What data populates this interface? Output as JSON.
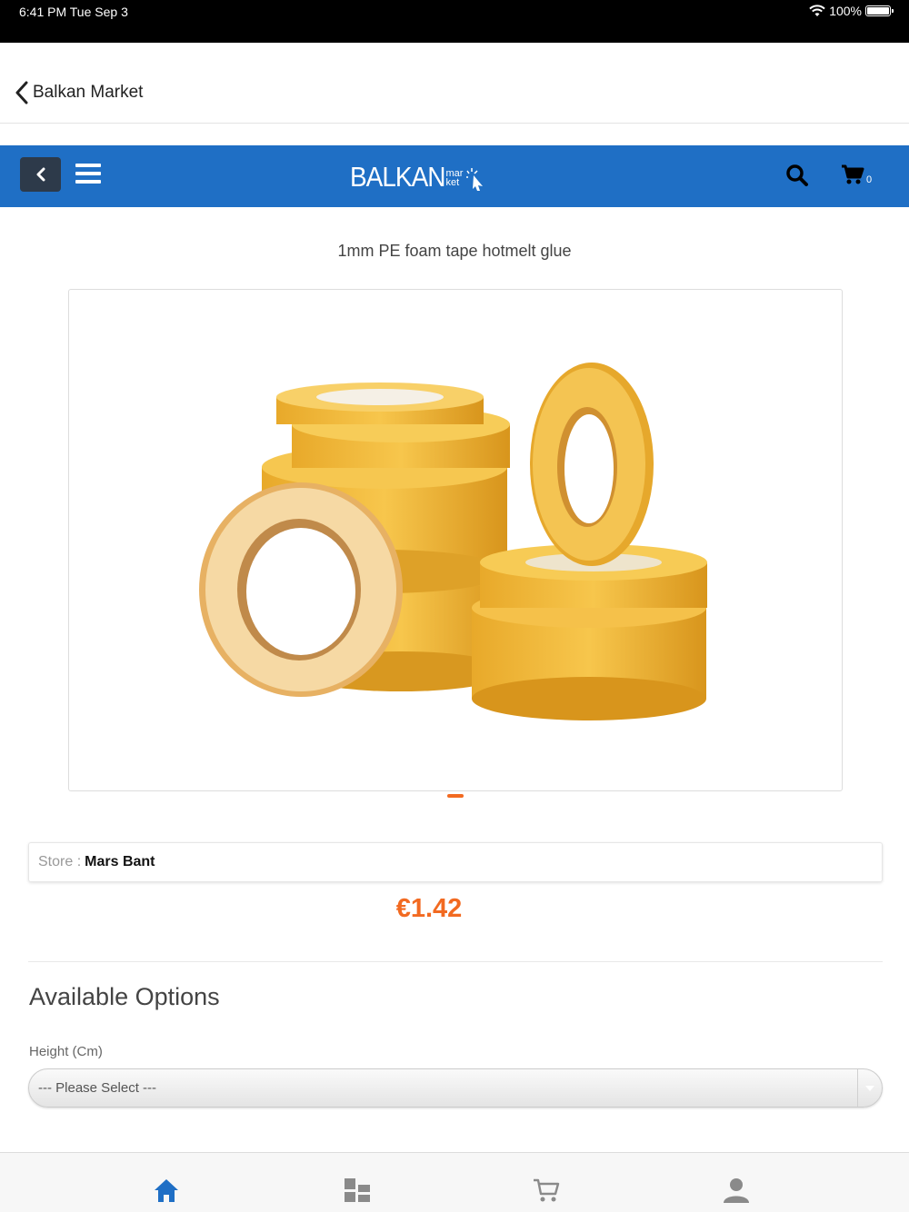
{
  "status_bar": {
    "time": "6:41 PM   Tue Sep 3",
    "battery": "100%"
  },
  "top_nav": {
    "back_label": "Balkan Market"
  },
  "header": {
    "logo_main": "BALKAN",
    "logo_sub": "mar ket",
    "cart_count": "0"
  },
  "product": {
    "title": "1mm PE foam tape hotmelt glue",
    "store_label": "Store :",
    "store_name": "Mars Bant",
    "price": "€1.42"
  },
  "options": {
    "heading": "Available Options",
    "height_label": "Height (Cm)",
    "height_select": "--- Please Select ---"
  },
  "tabs": [
    {
      "icon": "home-icon",
      "active": true
    },
    {
      "icon": "categories-icon",
      "active": false
    },
    {
      "icon": "cart-icon",
      "active": false
    },
    {
      "icon": "user-icon",
      "active": false
    }
  ],
  "colors": {
    "header_blue": "#1f6fc5",
    "accent_orange": "#f26a21",
    "tab_active": "#1f6fc5",
    "tab_inactive": "#8a8a8a"
  }
}
